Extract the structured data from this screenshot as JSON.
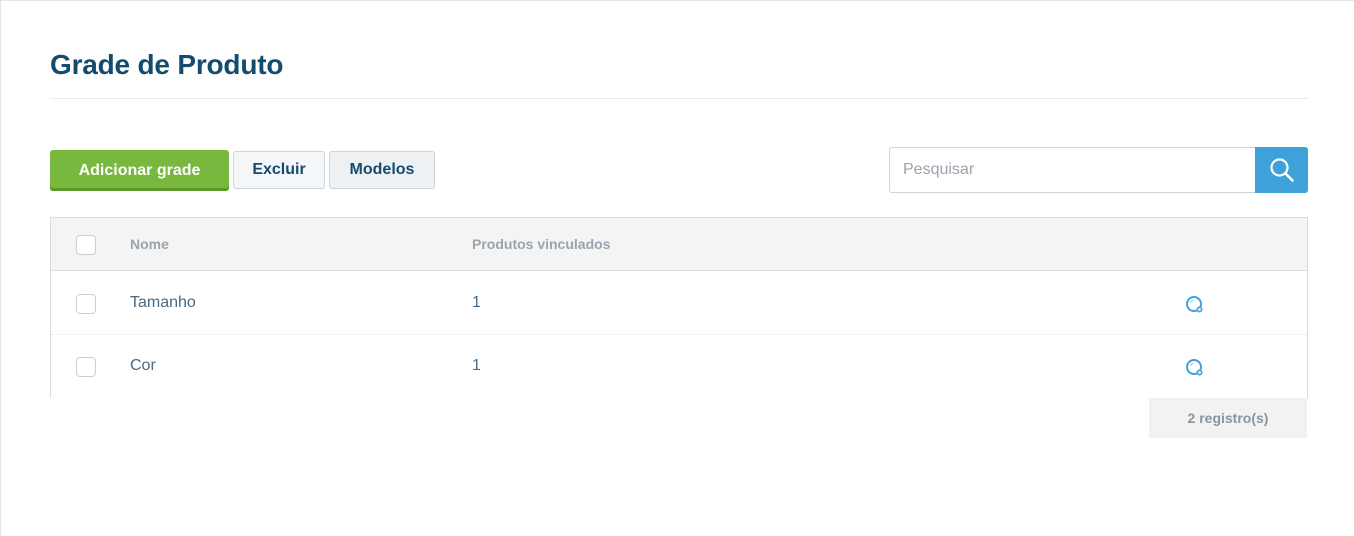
{
  "page": {
    "title": "Grade de Produto"
  },
  "toolbar": {
    "add_label": "Adicionar grade",
    "delete_label": "Excluir",
    "models_label": "Modelos"
  },
  "search": {
    "placeholder": "Pesquisar",
    "value": "",
    "icon": "search-icon"
  },
  "table": {
    "columns": [
      "Nome",
      "Produtos vinculados"
    ],
    "rows": [
      {
        "name": "Tamanho",
        "linked": "1",
        "action_icon": "search-detail-icon"
      },
      {
        "name": "Cor",
        "linked": "1",
        "action_icon": "search-detail-icon"
      }
    ]
  },
  "footer": {
    "count_label": "2 registro(s)"
  },
  "colors": {
    "title": "#144c70",
    "primary_button": "#79b83f",
    "search_button": "#3ea1da",
    "action_icon": "#3ea1da"
  }
}
